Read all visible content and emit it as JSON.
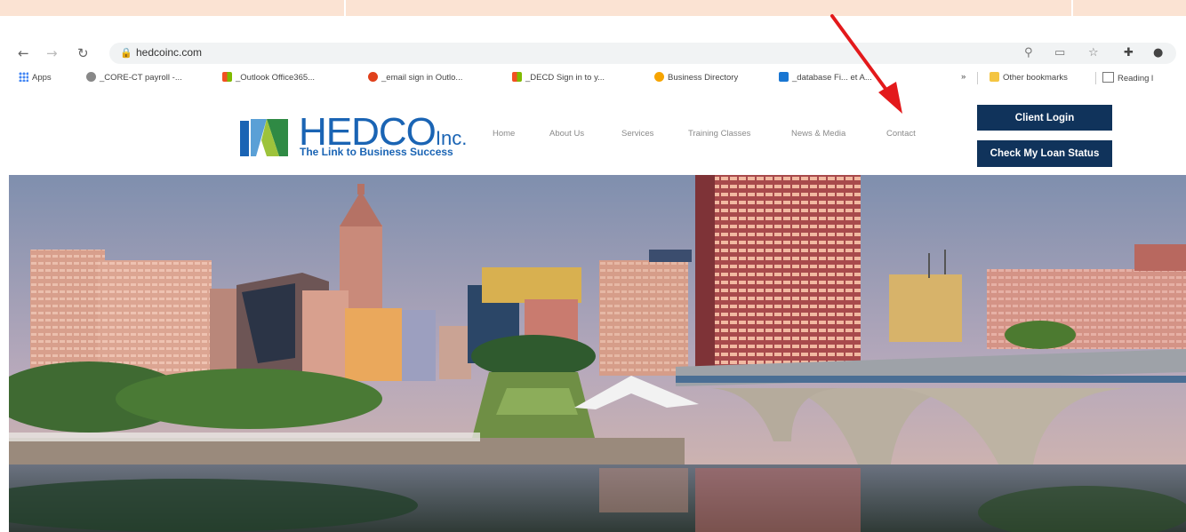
{
  "browser": {
    "url": "hedcoinc.com",
    "icons": {
      "back": "back-arrow-icon",
      "forward": "forward-arrow-icon",
      "reload": "reload-icon",
      "lock": "lock-icon",
      "zoom": "zoom-icon",
      "screen": "cast-icon",
      "star": "star-icon",
      "extensions": "puzzle-icon",
      "profile": "profile-icon"
    }
  },
  "bookmarks": {
    "apps": "Apps",
    "items": [
      "_CORE-CT payroll -...",
      "_Outlook Office365...",
      "_email sign in Outlo...",
      "_DECD Sign in to y...",
      "Business Directory",
      "_database Fi... et A..."
    ],
    "more": "»",
    "other": "Other bookmarks",
    "reading": "Reading l"
  },
  "site": {
    "brand": {
      "name": "HEDCO",
      "suffix": "Inc.",
      "tagline": "The Link to Business Success"
    },
    "nav": [
      "Home",
      "About Us",
      "Services",
      "Training Classes",
      "News & Media",
      "Contact"
    ],
    "buttons": {
      "client_login": "Client Login",
      "loan_status": "Check My Loan Status"
    }
  },
  "colors": {
    "brand_blue": "#1a64b4",
    "button_navy": "#10335b",
    "annotation_red": "#e3191b",
    "strip": "#fbe3d3"
  }
}
